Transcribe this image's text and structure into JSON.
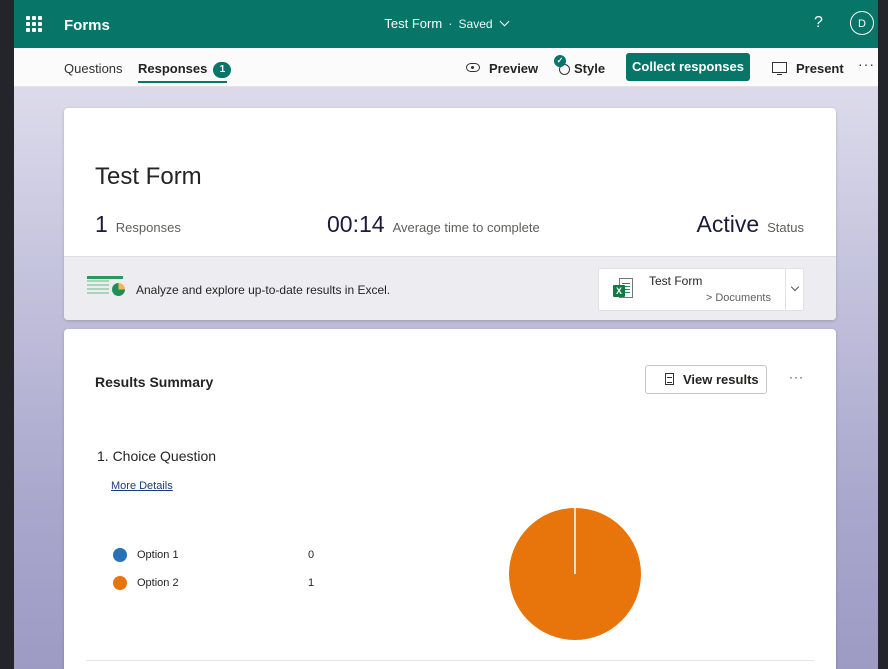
{
  "app": {
    "name": "Forms",
    "form_title": "Test Form",
    "save_state": "Saved",
    "help_label": "?",
    "user_initial": "D"
  },
  "tabs": {
    "questions": "Questions",
    "responses": "Responses",
    "responses_count": "1"
  },
  "toolbar": {
    "preview": "Preview",
    "style": "Style",
    "collect": "Collect responses",
    "present": "Present",
    "more": "···"
  },
  "summary_card": {
    "title": "Test Form",
    "responses_value": "1",
    "responses_label": "Responses",
    "avg_time_value": "00:14",
    "avg_time_label": "Average time to complete",
    "status_value": "Active",
    "status_label": "Status",
    "excel_prompt": "Analyze and explore up-to-date results in Excel.",
    "file_name": "Test Form",
    "file_path": "> Documents"
  },
  "results": {
    "title": "Results Summary",
    "view_results": "View results",
    "more": "···",
    "question": "1. Choice Question",
    "more_details": "More Details",
    "options": [
      {
        "label": "Option 1",
        "count": "0",
        "color": "#2a72b5"
      },
      {
        "label": "Option 2",
        "count": "1",
        "color": "#e8740c"
      }
    ]
  },
  "chart_data": {
    "type": "pie",
    "categories": [
      "Option 1",
      "Option 2"
    ],
    "values": [
      0,
      1
    ],
    "colors": [
      "#2a72b5",
      "#e8740c"
    ]
  },
  "colors": {
    "accent": "#077568",
    "pie_option2": "#e8740c",
    "pie_option1": "#2a72b5"
  }
}
